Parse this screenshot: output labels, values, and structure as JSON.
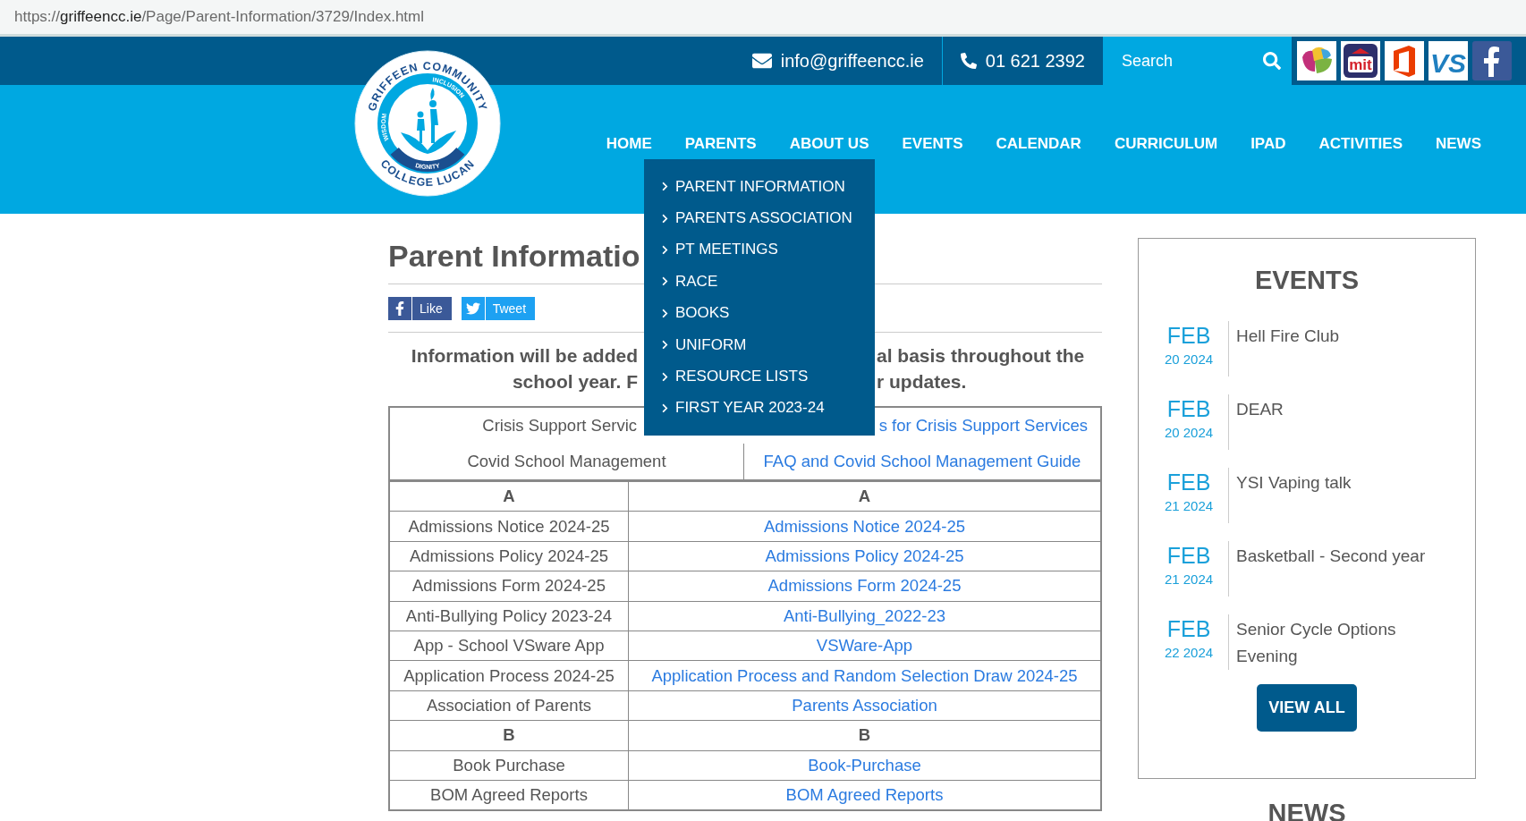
{
  "address": {
    "scheme": "https://",
    "host": "griffeencc.ie",
    "path": "/Page/Parent-Information/3729/Index.html"
  },
  "topbar": {
    "email": "info@griffeencc.ie",
    "phone": "01 621 2392",
    "search": {
      "placeholder": "Search"
    },
    "apps": [
      {
        "kind": "leaves"
      },
      {
        "kind": "mit",
        "label": "mit"
      },
      {
        "kind": "office"
      },
      {
        "kind": "vs",
        "label": "VS"
      },
      {
        "kind": "facebook"
      }
    ]
  },
  "logo": {
    "top": "GRIFFEEN COMMUNITY",
    "inner_top": "INCLUSION",
    "inner_left": "WISDOM",
    "inner_bottom": "DIGNITY",
    "bottom": "COLLEGE LUCAN"
  },
  "nav": [
    "HOME",
    "PARENTS",
    "ABOUT US",
    "EVENTS",
    "CALENDAR",
    "CURRICULUM",
    "IPAD",
    "ACTIVITIES",
    "NEWS"
  ],
  "dropdown": [
    "PARENT INFORMATION",
    "PARENTS ASSOCIATION",
    "PT MEETINGS",
    "RACE",
    "BOOKS",
    "UNIFORM",
    "RESOURCE LISTS",
    "FIRST YEAR 2023-24"
  ],
  "page": {
    "title": "Parent Informatio",
    "share": [
      {
        "kind": "facebook",
        "label": "Like"
      },
      {
        "kind": "twitter",
        "label": "Tweet"
      }
    ],
    "intro": [
      {
        "left": "Information will be added",
        "right": "al basis throughout the"
      },
      {
        "left": "school year. F",
        "right": "r updates."
      }
    ],
    "notices": [
      {
        "label": "Crisis Support Servic",
        "link": "s for Crisis Support Services"
      },
      {
        "label": "Covid School Management",
        "link": "FAQ and Covid School Management Guide"
      }
    ],
    "rows": [
      {
        "kind": "heading",
        "left": "A",
        "right": "A"
      },
      {
        "kind": "entry",
        "left": "Admissions Notice 2024-25",
        "right": "Admissions Notice 2024-25"
      },
      {
        "kind": "entry",
        "left": "Admissions Policy 2024-25",
        "right": "Admissions Policy 2024-25"
      },
      {
        "kind": "entry",
        "left": "Admissions Form 2024-25",
        "right": "Admissions Form 2024-25"
      },
      {
        "kind": "entry",
        "left": "Anti-Bullying Policy 2023-24",
        "right": "Anti-Bullying_2022-23"
      },
      {
        "kind": "entry",
        "left": "App - School VSware App",
        "right": "VSWare-App"
      },
      {
        "kind": "entry",
        "left": "Application Process 2024-25",
        "right": "Application Process and Random Selection Draw 2024-25"
      },
      {
        "kind": "entry",
        "left": "Association of Parents",
        "right": "Parents Association"
      },
      {
        "kind": "heading",
        "left": "B",
        "right": "B"
      },
      {
        "kind": "entry",
        "left": "Book Purchase",
        "right": "Book-Purchase"
      },
      {
        "kind": "entry",
        "left": "BOM Agreed Reports",
        "right": "BOM Agreed Reports"
      }
    ]
  },
  "events": {
    "title": "EVENTS",
    "items": [
      {
        "month": "FEB",
        "date": "20 2024",
        "title": "Hell Fire Club"
      },
      {
        "month": "FEB",
        "date": "20 2024",
        "title": "DEAR"
      },
      {
        "month": "FEB",
        "date": "21 2024",
        "title": "YSI Vaping talk"
      },
      {
        "month": "FEB",
        "date": "21 2024",
        "title": "Basketball - Second year"
      },
      {
        "month": "FEB",
        "date": "22 2024",
        "title": "Senior Cycle Options Evening"
      }
    ],
    "button": "VIEW ALL"
  },
  "news": {
    "title": "NEWS"
  }
}
